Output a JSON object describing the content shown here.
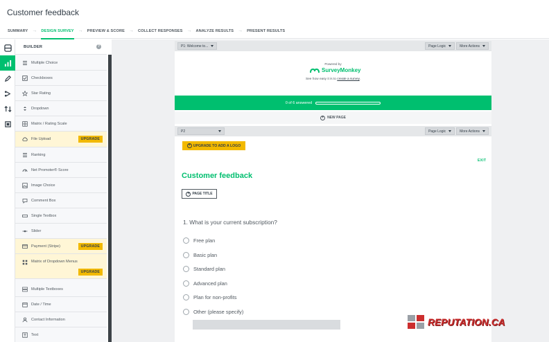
{
  "app": {
    "title": "Customer feedback"
  },
  "steps": [
    {
      "label": "SUMMARY",
      "active": false
    },
    {
      "label": "DESIGN SURVEY",
      "active": true
    },
    {
      "label": "PREVIEW & SCORE",
      "active": false
    },
    {
      "label": "COLLECT RESPONSES",
      "active": false
    },
    {
      "label": "ANALYZE RESULTS",
      "active": false
    },
    {
      "label": "PRESENT RESULTS",
      "active": false
    }
  ],
  "builder": {
    "title": "BUILDER",
    "help": "?",
    "upgrade_label": "UPGRADE",
    "items": [
      {
        "label": "Multiple Choice",
        "icon": "list-icon"
      },
      {
        "label": "Checkboxes",
        "icon": "checkbox-icon"
      },
      {
        "label": "Star Rating",
        "icon": "star-icon"
      },
      {
        "label": "Dropdown",
        "icon": "dropdown-icon"
      },
      {
        "label": "Matrix / Rating Scale",
        "icon": "grid-icon"
      },
      {
        "label": "File Upload",
        "icon": "cloud-upload-icon",
        "upgrade": true
      },
      {
        "label": "Ranking",
        "icon": "ranking-icon"
      },
      {
        "label": "Net Promoter® Score",
        "icon": "gauge-icon"
      },
      {
        "label": "Image Choice",
        "icon": "image-icon"
      },
      {
        "label": "Comment Box",
        "icon": "comment-icon"
      },
      {
        "label": "Single Textbox",
        "icon": "textbox-icon"
      },
      {
        "label": "Slider",
        "icon": "slider-icon"
      },
      {
        "label": "Payment (Stripe)",
        "icon": "card-icon",
        "upgrade": true
      },
      {
        "label": "Matrix of Dropdown Menus",
        "icon": "matrix-dropdown-icon",
        "upgrade": true
      },
      {
        "label": "Multiple Textboxes",
        "icon": "multi-textbox-icon"
      },
      {
        "label": "Date / Time",
        "icon": "calendar-icon"
      },
      {
        "label": "Contact Information",
        "icon": "contact-icon"
      },
      {
        "label": "Text",
        "icon": "text-icon"
      }
    ]
  },
  "page1": {
    "select": "P1: Welcome to...",
    "logic": "Page Logic",
    "more": "More Actions"
  },
  "page2": {
    "select": "P2",
    "logic": "Page Logic",
    "more": "More Actions"
  },
  "header": {
    "powered_by": "Powered by",
    "brand": "SurveyMonkey",
    "tagline_prefix": "See how easy it is to",
    "tagline_link": "create a survey",
    "tagline_suffix": "."
  },
  "progress": {
    "text": "0 of 6 answered",
    "fraction": 0
  },
  "new_page": "NEW PAGE",
  "logo_button": "UPGRADE TO ADD A LOGO",
  "exit": "EXIT",
  "survey": {
    "title": "Customer feedback",
    "page_title_button": "PAGE TITLE",
    "question": "1. What is your current subscription?",
    "options": [
      "Free plan",
      "Basic plan",
      "Standard plan",
      "Advanced plan",
      "Plan for non-profits",
      "Other (please specify)"
    ]
  },
  "watermark": {
    "text": "REPUTATION.CA"
  },
  "colors": {
    "accent": "#00bf6f",
    "upgrade": "#f2b900",
    "rail": "#3c4247",
    "watermark": "#cc2e2e"
  }
}
